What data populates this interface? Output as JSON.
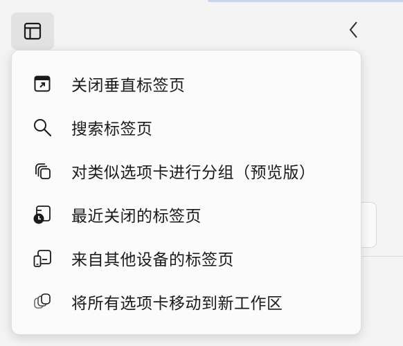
{
  "toolbar": {
    "sidebar_button_icon": "sidebar-toggle-icon",
    "collapse_button_icon": "chevron-left-icon"
  },
  "menu": {
    "items": [
      {
        "label": "关闭垂直标签页",
        "icon": "close-vertical-tabs-icon"
      },
      {
        "label": "搜索标签页",
        "icon": "search-icon"
      },
      {
        "label": "对类似选项卡进行分组（预览版）",
        "icon": "group-tabs-icon"
      },
      {
        "label": "最近关闭的标签页",
        "icon": "recently-closed-icon"
      },
      {
        "label": "来自其他设备的标签页",
        "icon": "other-devices-icon"
      },
      {
        "label": "将所有选项卡移动到新工作区",
        "icon": "move-to-workspace-icon"
      }
    ]
  }
}
